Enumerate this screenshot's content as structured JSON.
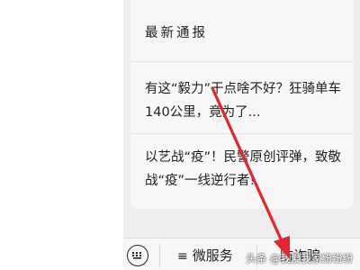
{
  "menu": {
    "items": [
      {
        "label": "最新通报"
      },
      {
        "label": "有这“毅力”干点啥不好？狂骑单车140公里，竟为了..."
      },
      {
        "label": "以艺战“疫”！民警原创评弹，致敬战“疫”一线逆行者!"
      }
    ]
  },
  "bottom_bar": {
    "tab_micro_service": {
      "icon": "menu-lines-icon",
      "label": "微服务"
    },
    "tab_anti_fraud": {
      "label": "防诈骗"
    }
  },
  "watermark": {
    "text": "头条 @我爱我家纷纷纷"
  },
  "colors": {
    "annotation_arrow": "#e6262e",
    "bar_bg": "#f7f7f7",
    "page_bg": "#ededed"
  }
}
